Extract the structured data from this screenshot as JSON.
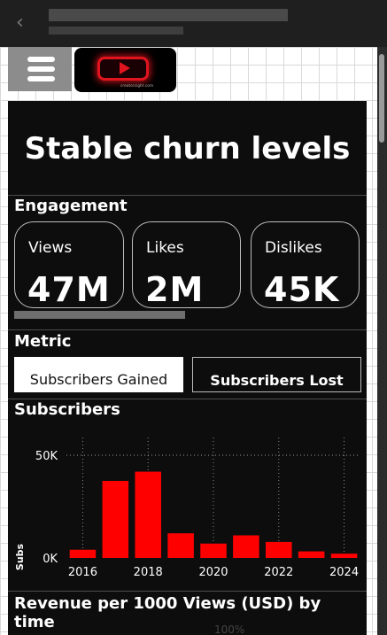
{
  "topbar": {
    "back_icon": "chevron-left-icon"
  },
  "menu": {
    "icon": "hamburger-menu-icon"
  },
  "logo": {
    "icon": "play-button-icon",
    "tagline": "creatorsight.com"
  },
  "headline": "Stable churn levels",
  "engagement": {
    "label": "Engagement",
    "cards": [
      {
        "label": "Views",
        "value": "47M"
      },
      {
        "label": "Likes",
        "value": "2M"
      },
      {
        "label": "Dislikes",
        "value": "45K"
      }
    ]
  },
  "metric": {
    "label": "Metric",
    "options": [
      "Subscribers Gained",
      "Subscribers Lost"
    ],
    "selected": "Subscribers Gained"
  },
  "subscribers": {
    "label": "Subscribers",
    "bar_color": "#ff0000"
  },
  "chart_data": {
    "type": "bar",
    "x": [
      2016,
      2017,
      2018,
      2019,
      2020,
      2021,
      2022,
      2023,
      2024
    ],
    "values": [
      4000,
      37500,
      42000,
      12000,
      7000,
      11000,
      7800,
      3200,
      2100
    ],
    "xticks": [
      "2016",
      "2018",
      "2020",
      "2022",
      "2024"
    ],
    "yticks": [
      "0K",
      "50K"
    ],
    "ylabel": "Subs",
    "ylim": [
      0,
      50000
    ],
    "grid": true
  },
  "revenue": {
    "label": "Revenue per 1000 Views (USD) by time",
    "peek_value": "100%"
  }
}
